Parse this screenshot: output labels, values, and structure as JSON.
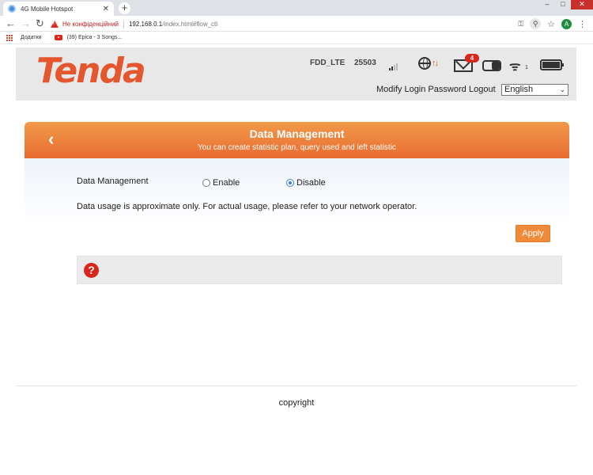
{
  "browser": {
    "tab_title": "4G Mobile Hotspot",
    "tab_close": "✕",
    "new_tab": "+",
    "security_label": "Не конфіденційний",
    "url_host": "192.168.0.1",
    "url_path": "/index.html#flow_ctl",
    "profile_initial": "A",
    "bookmarks": {
      "apps_label": "Додатки",
      "item1": "(39) Epica - 3 Songs..."
    }
  },
  "header": {
    "logo": "Tenda",
    "network_type": "FDD_LTE",
    "network_code": "25503",
    "message_count": "4",
    "wifi_clients": "1",
    "modify_password": "Modify Login Password",
    "logout": "Logout",
    "language": "English"
  },
  "panel": {
    "title": "Data Management",
    "subtitle": "You can create statistic plan, query used and left statistic",
    "field_label": "Data Management",
    "options": [
      "Enable",
      "Disable"
    ],
    "selected": "Disable",
    "note": "Data usage is approximate only. For actual usage, please refer to your network operator.",
    "apply_label": "Apply",
    "help_icon": "?"
  },
  "footer": {
    "copyright": "copyright"
  },
  "colors": {
    "brand": "#e4572e",
    "panel_header_top": "#f19a4a",
    "panel_header_bottom": "#e86b31",
    "apply_button": "#ee8a38",
    "badge": "#d9261c"
  }
}
